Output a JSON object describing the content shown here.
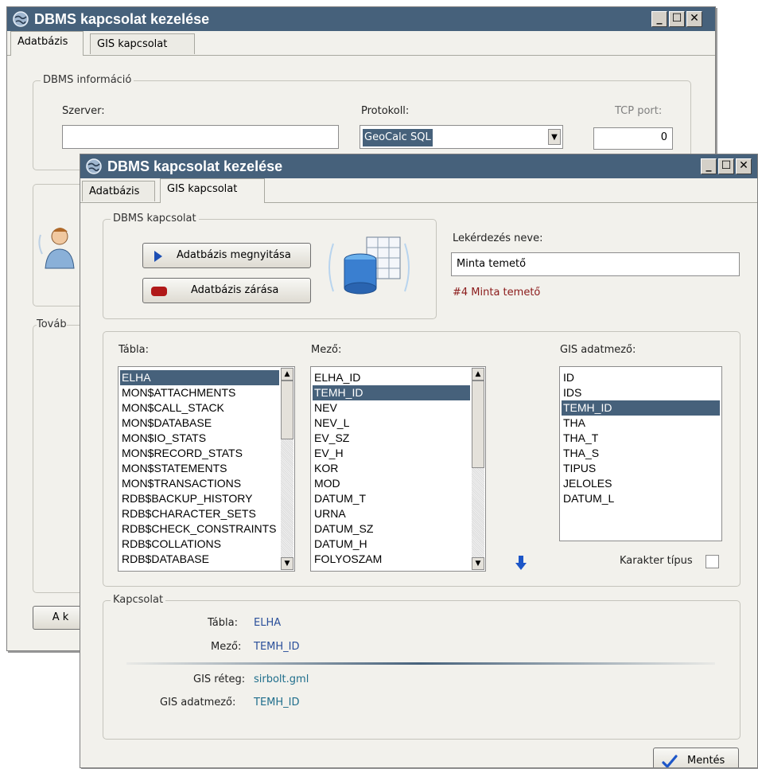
{
  "back_window": {
    "title": "DBMS kapcsolat kezelése",
    "tabs": [
      "Adatbázis",
      "GIS kapcsolat"
    ],
    "dbms_info_legend": "DBMS információ",
    "server_label": "Szerver:",
    "server_value": "",
    "protocol_label": "Protokoll:",
    "protocol_value": "GeoCalc SQL",
    "tcp_label": "TCP port:",
    "tcp_value": "0",
    "partial_legend": "Továb",
    "partial_button": "A k"
  },
  "front_window": {
    "title": "DBMS kapcsolat kezelése",
    "tabs": [
      "Adatbázis",
      "GIS kapcsolat"
    ],
    "dbms_conn_legend": "DBMS kapcsolat",
    "open_button": "Adatbázis megnyitása",
    "close_button": "Adatbázis zárása",
    "query_name_label": "Lekérdezés neve:",
    "query_name_value": "Minta temető",
    "query_info": "#4 Minta temető",
    "table_label": "Tábla:",
    "tables": [
      "ELHA",
      "MON$ATTACHMENTS",
      "MON$CALL_STACK",
      "MON$DATABASE",
      "MON$IO_STATS",
      "MON$RECORD_STATS",
      "MON$STATEMENTS",
      "MON$TRANSACTIONS",
      "RDB$BACKUP_HISTORY",
      "RDB$CHARACTER_SETS",
      "RDB$CHECK_CONSTRAINTS",
      "RDB$COLLATIONS",
      "RDB$DATABASE"
    ],
    "field_label": "Mező:",
    "fields": [
      "ELHA_ID",
      "TEMH_ID",
      "NEV",
      "NEV_L",
      "EV_SZ",
      "EV_H",
      "KOR",
      "MOD",
      "DATUM_T",
      "URNA",
      "DATUM_SZ",
      "DATUM_H",
      "FOLYOSZAM"
    ],
    "gis_field_label": "GIS adatmező:",
    "gis_fields": [
      "ID",
      "IDS",
      "TEMH_ID",
      "THA",
      "THA_T",
      "THA_S",
      "TIPUS",
      "JELOLES",
      "DATUM_L"
    ],
    "char_type_label": "Karakter típus",
    "connection_legend": "Kapcsolat",
    "conn_table_label": "Tábla:",
    "conn_table_value": "ELHA",
    "conn_field_label": "Mező:",
    "conn_field_value": "TEMH_ID",
    "conn_layer_label": "GIS réteg:",
    "conn_layer_value": "sirbolt.gml",
    "conn_gisfield_label": "GIS adatmező:",
    "conn_gisfield_value": "TEMH_ID",
    "save_button": "Mentés"
  },
  "colors": {
    "titlebar": "#46617b",
    "selection": "#46617b",
    "link_blue": "#2a4f9a",
    "info_red": "#8b1a1a"
  }
}
